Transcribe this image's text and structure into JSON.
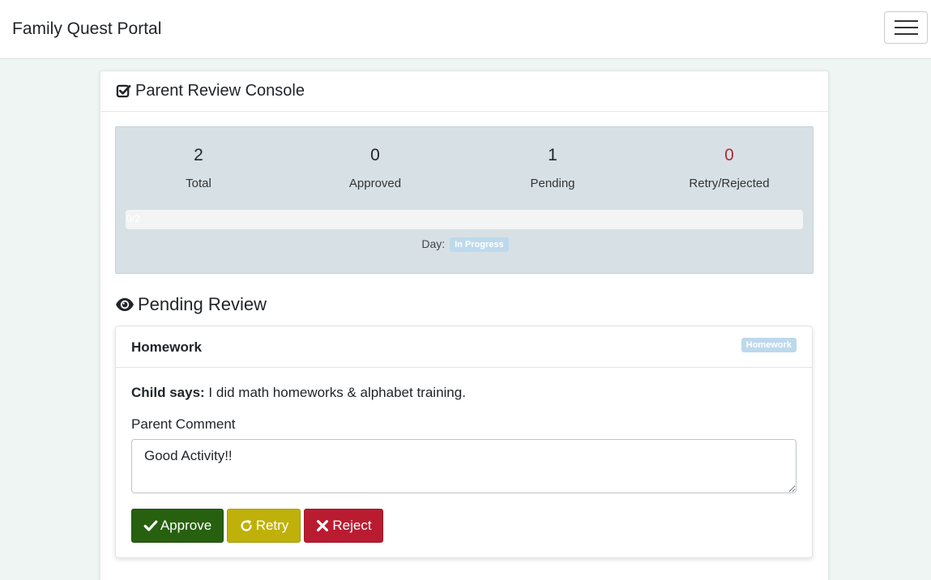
{
  "navbar": {
    "brand": "Family Quest Portal",
    "menu_icon": "hamburger-icon"
  },
  "console": {
    "title": "Parent Review Console",
    "title_icon": "check-square-icon",
    "stats": [
      {
        "value": "2",
        "label": "Total"
      },
      {
        "value": "0",
        "label": "Approved"
      },
      {
        "value": "1",
        "label": "Pending"
      },
      {
        "value": "0",
        "label": "Retry/Rejected"
      }
    ],
    "progress_text": "0/2",
    "progress_fraction": 0,
    "day_label": "Day:",
    "day_status": "In Progress"
  },
  "pending": {
    "title": "Pending Review",
    "title_icon": "eye-icon",
    "task": {
      "name": "Homework",
      "category": "Homework",
      "child_says_label": "Child says:",
      "child_says_text": " I did math homeworks & alphabet training.",
      "comment_label": "Parent Comment",
      "comment_value": "Good Activity!!"
    },
    "actions": {
      "approve": "Approve",
      "retry": "Retry",
      "reject": "Reject"
    }
  },
  "colors": {
    "approve": "#27600f",
    "retry": "#bfb10a",
    "reject": "#b91c30",
    "rejected_count": "#b02a37",
    "badge": "#bdd9ec"
  }
}
